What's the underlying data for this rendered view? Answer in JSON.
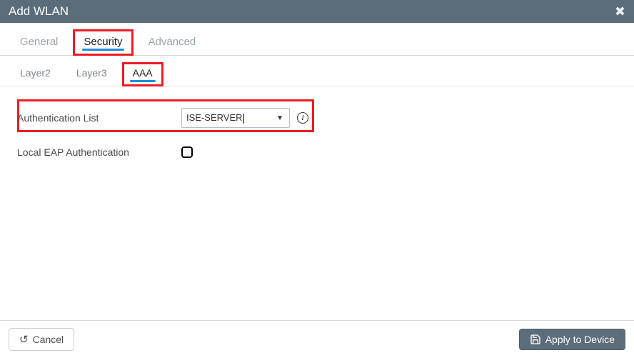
{
  "header": {
    "title": "Add WLAN"
  },
  "primary_tabs": [
    {
      "label": "General"
    },
    {
      "label": "Security"
    },
    {
      "label": "Advanced"
    }
  ],
  "secondary_tabs": [
    {
      "label": "Layer2"
    },
    {
      "label": "Layer3"
    },
    {
      "label": "AAA"
    }
  ],
  "form": {
    "auth_list_label": "Authentication List",
    "auth_list_value": "ISE-SERVER",
    "local_eap_label": "Local EAP Authentication",
    "local_eap_checked": false
  },
  "footer": {
    "cancel_label": "Cancel",
    "apply_label": "Apply to Device"
  }
}
